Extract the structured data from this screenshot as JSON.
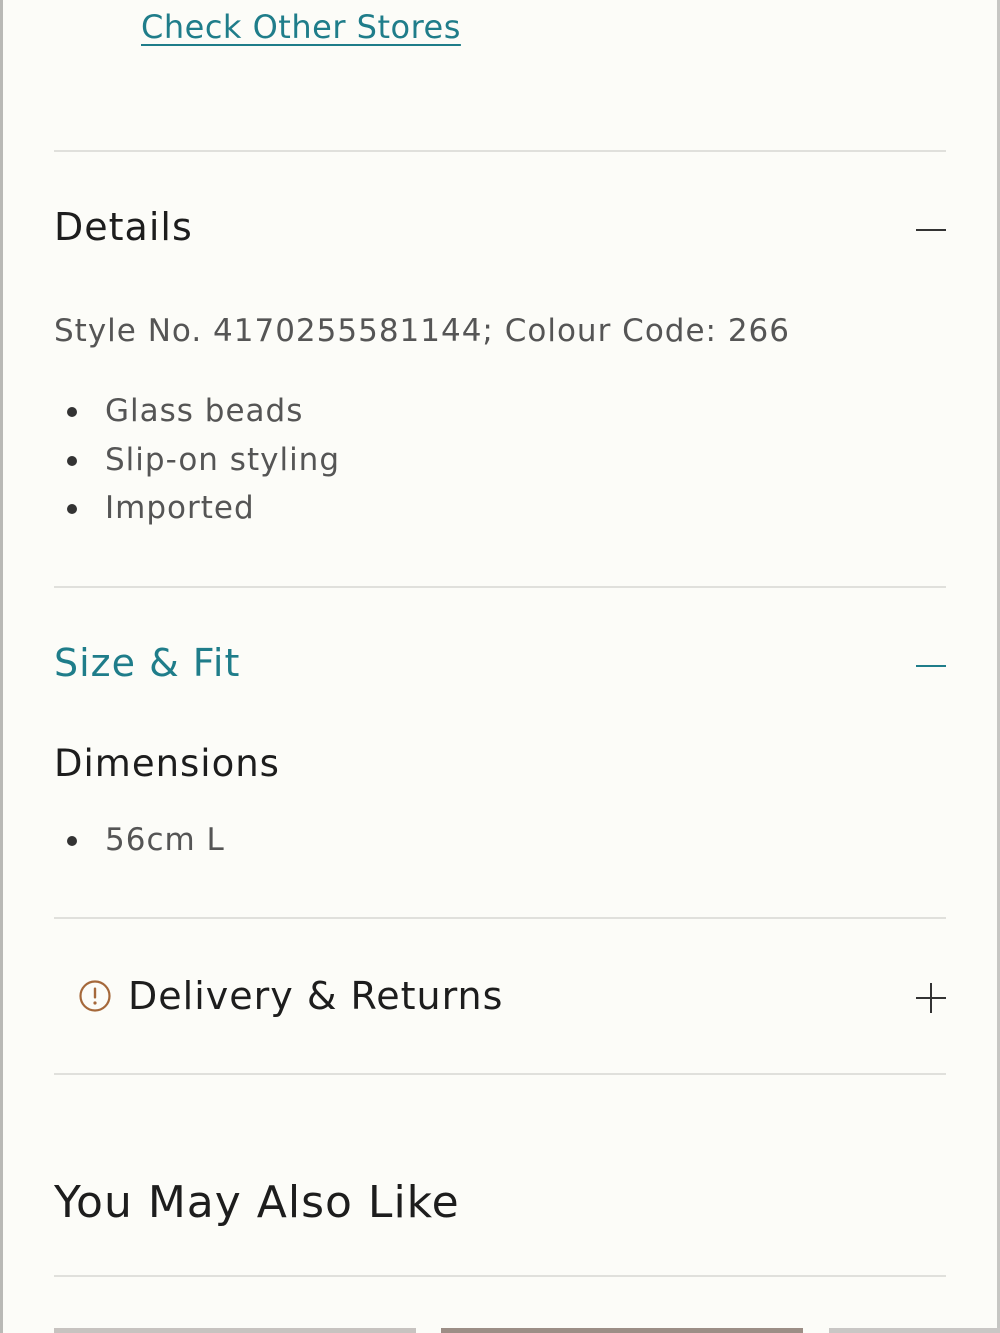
{
  "store_link": {
    "label": "Check Other Stores"
  },
  "details": {
    "title": "Details",
    "toggle_icon": "minus-icon",
    "style_line": "Style No. 4170255581144; Colour Code: 266",
    "features": [
      "Glass beads",
      "Slip-on styling",
      "Imported"
    ]
  },
  "size_fit": {
    "title": "Size & Fit",
    "toggle_icon": "minus-icon",
    "dimensions_title": "Dimensions",
    "dimensions": [
      "56cm L"
    ]
  },
  "delivery": {
    "title": "Delivery & Returns",
    "status_icon": "info-circle-icon",
    "toggle_icon": "plus-icon"
  },
  "recommendations": {
    "title": "You May Also Like"
  },
  "colors": {
    "background": "#fcfcf8",
    "accent_teal": "#1f7d8a",
    "info_icon": "#a5683a",
    "text_dark": "#1d1d1d",
    "text_muted": "#555555",
    "divider": "#e0e0dc"
  }
}
